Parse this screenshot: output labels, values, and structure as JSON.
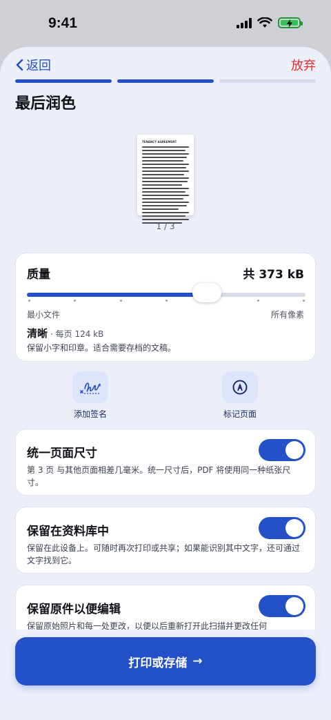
{
  "status": {
    "time": "9:41"
  },
  "nav": {
    "back_label": "返回",
    "discard_label": "放弃"
  },
  "steps": {
    "total": 3,
    "completed": 2
  },
  "page": {
    "title": "最后润色"
  },
  "preview": {
    "doc_title": "TENANCY AGREEMENT",
    "page_indicator": "1 / 3"
  },
  "quality": {
    "label": "质量",
    "total_size": "共 373 kB",
    "min_label": "最小文件",
    "max_label": "所有像素",
    "level_label": "清晰",
    "per_page": "· 每页 124 kB",
    "description": "保留小字和印章。适合需要存档的文稿。",
    "slider_value": 0.645
  },
  "actions": [
    {
      "label": "添加签名",
      "icon": "signature-icon"
    },
    {
      "label": "标记页面",
      "icon": "pen-marker-icon"
    }
  ],
  "options": [
    {
      "title": "统一页面尺寸",
      "description": "第 3 页 与其他页面相差几毫米。统一尺寸后，PDF 将使用同一种纸张尺寸。",
      "enabled": true
    },
    {
      "title": "保留在资料库中",
      "description": "保留在此设备上。可随时再次打印或共享；如果能识别其中文字，还可通过文字找到它。",
      "enabled": true
    },
    {
      "title": "保留原件以便编辑",
      "description": "保留原始照片和每一处更改，以便以后重新打开此扫描并更改任何",
      "enabled": true
    }
  ],
  "primary_button": {
    "label": "打印或存储",
    "arrow": "→"
  },
  "colors": {
    "accent": "#2450c8",
    "destructive": "#e0312e",
    "background": "#eceef8"
  }
}
